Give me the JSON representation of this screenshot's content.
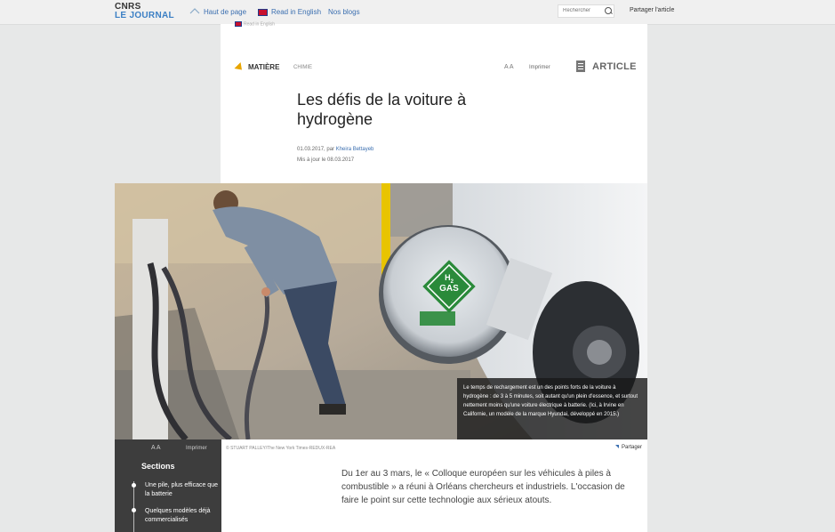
{
  "header": {
    "logo_line1": "CNRS",
    "logo_line2": "LE JOURNAL",
    "nav_top": "Haut de page",
    "nav_english": "Read in English",
    "nav_blogs": "Nos blogs",
    "search_placeholder": "Rechercher",
    "share": "Partager l'article"
  },
  "article": {
    "read_english_small": "Read in English",
    "category": "MATIÈRE",
    "subcategory": "CHIMIE",
    "font_size_control": "A A",
    "print": "Imprimer",
    "type_label": "ARTICLE",
    "title": "Les défis de la voiture à hydrogène",
    "date_prefix": "01.03.2017, par ",
    "author": "Kheira Bettayeb",
    "updated": "Mis à jour le 08.03.2017"
  },
  "hero": {
    "badge_line1": "H",
    "badge_sub": "2",
    "badge_line2": "GAS",
    "caption": "Le temps de rechargement est un des points forts de la voiture à hydrogène : de 3 à 5 minutes, soit autant qu'un plein d'essence, et surtout nettement moins qu'une voiture électrique à batterie. (Ici, à Irvine en Californie, un modèle de la marque Hyundai, développé en 2015.)",
    "credit": "© STUART PALLEY/The New York Times-REDUX-REA",
    "share": "Partager"
  },
  "sidebar": {
    "font_size_control": "A A",
    "print": "Imprimer",
    "sections_title": "Sections",
    "items": [
      {
        "label": "Une pile, plus efficace que la batterie"
      },
      {
        "label": "Quelques modèles déjà commercialisés"
      }
    ]
  },
  "body": {
    "intro": "Du 1er au 3 mars, le « Colloque européen sur les véhicules à piles à combustible » a réuni à Orléans chercheurs et industriels. L'occasion de faire le point sur cette technologie aux sérieux atouts."
  },
  "colors": {
    "accent_blue": "#3b6fb0",
    "accent_orange": "#e8a500",
    "sidebar_bg": "#3d3d3d",
    "badge_green": "#2a8a3a"
  }
}
